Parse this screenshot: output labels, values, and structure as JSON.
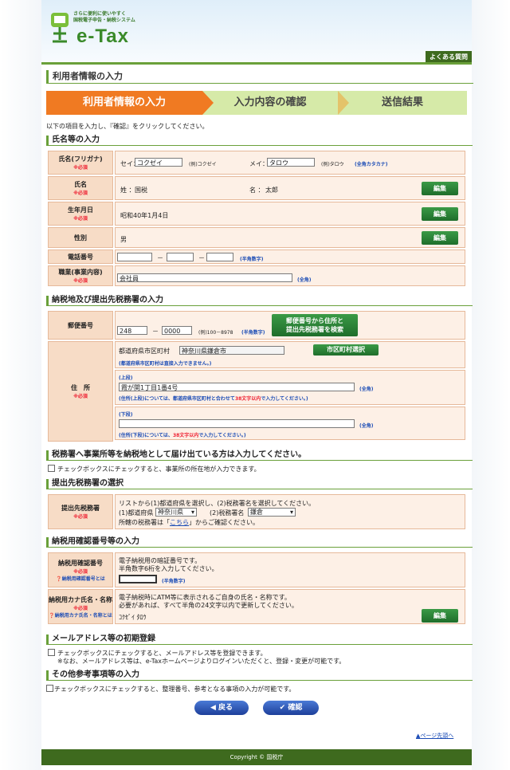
{
  "header": {
    "logo_tagline_1": "さらに便利に使いやすく",
    "logo_tagline_2": "国税電子申告・納税システム",
    "logo_text": "e-Tax",
    "faq": "よくある質問"
  },
  "page_title": "利用者情報の入力",
  "steps": [
    "利用者情報の入力",
    "入力内容の確認",
    "送信結果"
  ],
  "intro": "以下の項目を入力し、『確認』をクリックしてください。",
  "required": "※必須",
  "edit_label": "編集",
  "name_section": {
    "heading": "氏名等の入力",
    "kana_label": "氏名(フリガナ)",
    "sei_label": "セイ：",
    "sei_value": "コクゼイ",
    "sei_example": "(例)コクゼイ",
    "mei_label": "メイ：",
    "mei_value": "タロウ",
    "mei_example": "(例)タロウ",
    "kana_note": "(全角カタカナ)",
    "name_label": "氏名",
    "last_label": "姓 ：",
    "last_value": "国税",
    "first_label": "名 ：",
    "first_value": "太郎",
    "birth_label": "生年月日",
    "birth_value": "昭和40年1月4日",
    "gender_label": "性別",
    "gender_value": "男",
    "phone_label": "電話番号",
    "phone_dash": "－",
    "phone_note": "(半角数字)",
    "job_label": "職業(事業内容)",
    "job_value": "会社員",
    "job_note": "(全角)"
  },
  "address_section": {
    "heading": "納税地及び提出先税務署の入力",
    "postal_label": "郵便番号",
    "postal_1": "248",
    "postal_dash": "－",
    "postal_2": "0000",
    "postal_example": "(例)100－8978",
    "postal_note": "(半角数字)",
    "postal_search_1": "郵便番号から住所と",
    "postal_search_2": "提出先税務署を検索",
    "address_label": "住　所",
    "city_label": "都道府県市区町村",
    "city_value": "神奈川県鎌倉市",
    "city_button": "市区町村選択",
    "city_note": "(都道府県市区町村は直接入力できません。)",
    "upper_label": "(上段)",
    "upper_value": "霞が関1丁目1番4号",
    "upper_note_prefix": "(住所(上段)については、都道府県市区町村と合わせて",
    "upper_note_limit": "38文字以内",
    "upper_note_suffix": "で入力してください。)",
    "lower_label": "(下段)",
    "lower_value": "",
    "lower_note_prefix": "(住所(下段)については、",
    "lower_note_limit": "38文字以内",
    "lower_note_suffix": "で入力してください。)",
    "zenkaku": "(全角)"
  },
  "office_section": {
    "heading": "税務署へ事業所等を納税地として届け出ている方は入力してください。",
    "checkbox_text": "チェックボックスにチェックすると、事業所の所在地が入力できます。"
  },
  "tax_office_section": {
    "heading": "提出先税務署の選択",
    "label": "提出先税務署",
    "line1": "リストから(1)都道府県を選択し、(2)税務署名を選択してください。",
    "pref_label": "(1)都道府県",
    "pref_value": "神奈川県",
    "office_label": "(2)税務署名",
    "office_value": "鎌倉",
    "line3_prefix": "所轄の税務署は「",
    "line3_link": "こちら",
    "line3_suffix": "」からご確認ください。"
  },
  "confirm_section": {
    "heading": "納税用確認番号等の入力",
    "pin_label": "納税用確認番号",
    "pin_help": "納税用確認番号とは",
    "pin_line1": "電子納税用の暗証番号です。",
    "pin_line2": "半角数字6桁を入力してください。",
    "pin_value": "",
    "pin_note": "(半角数字)",
    "kana_label": "納税用カナ氏名・名称",
    "kana_help": "納税用カナ氏名・名称とは",
    "kana_line1": "電子納税時にATM等に表示されるご自身の氏名・名称です。",
    "kana_line2": "必要があれば、すべて半角の24文字以内で更新してください。",
    "kana_value": "ｺｸｾﾞｲ ﾀﾛｳ"
  },
  "mail_section": {
    "heading": "メールアドレス等の初期登録",
    "line1": "チェックボックスにチェックすると、メールアドレス等を登録できます。",
    "line2": "※なお、メールアドレス等は、e-Taxホームページよりログインいただくと、登録・変更が可能です。"
  },
  "other_section": {
    "heading": "その他参考事項等の入力",
    "line1": "チェックボックスにチェックすると、整理番号、参考となる事項の入力が可能です。"
  },
  "buttons": {
    "back": "戻る",
    "confirm": "確認"
  },
  "page_top": "ページ先頭へ",
  "footer": "Copyright © 国税庁"
}
